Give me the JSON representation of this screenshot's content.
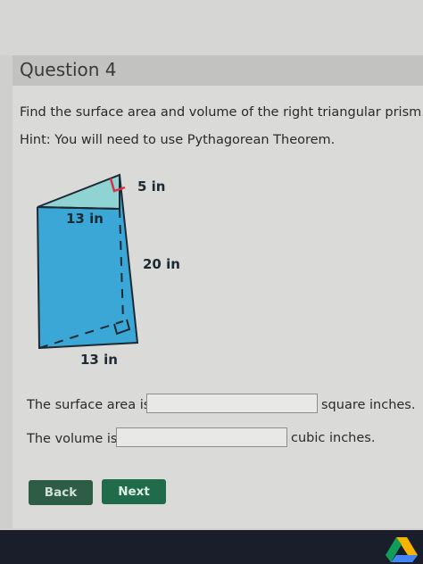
{
  "question": {
    "title": "Question 4",
    "prompt": "Find the surface area and volume of the right triangular prism.",
    "hint": "Hint:  You will need to use Pythagorean Theorem."
  },
  "figure": {
    "label_top_leg": "5 in",
    "label_top_base": "13 in",
    "label_height": "20 in",
    "label_bottom_base": "13 in",
    "face_color": "#3aa7d6",
    "top_color": "#8fd3d2"
  },
  "answers": {
    "surface_area_prefix": "The surface area is",
    "surface_area_suffix": "square inches.",
    "surface_area_value": "",
    "volume_prefix": "The volume is",
    "volume_suffix": "cubic inches.",
    "volume_value": ""
  },
  "nav": {
    "back_label": "Back",
    "next_label": "Next"
  }
}
